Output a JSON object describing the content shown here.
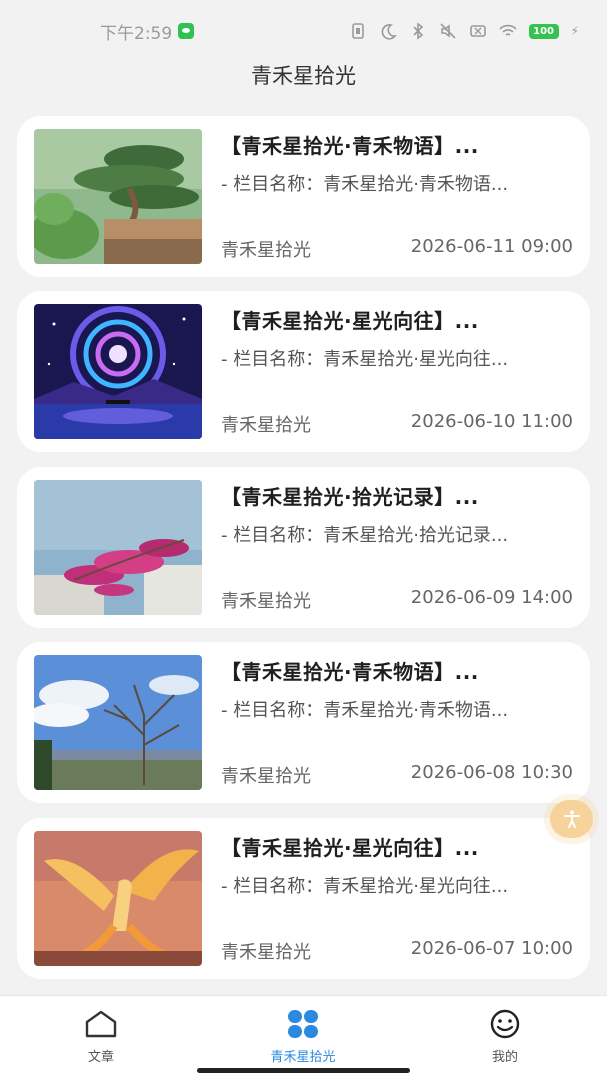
{
  "status_bar": {
    "time": "下午2:59",
    "battery": "100"
  },
  "header": {
    "title": "青禾星拾光"
  },
  "articles": [
    {
      "title": "【青禾星拾光·青禾物语】...",
      "desc": "- 栏目名称：青禾星拾光·青禾物语...",
      "author": "青禾星拾光",
      "date": "2026-06-11 09:00",
      "thumb": "bonsai-pine-image"
    },
    {
      "title": "【青禾星拾光·星光向往】...",
      "desc": "- 栏目名称：青禾星拾光·星光向往...",
      "author": "青禾星拾光",
      "date": "2026-06-10 11:00",
      "thumb": "galaxy-swirl-image"
    },
    {
      "title": "【青禾星拾光·拾光记录】...",
      "desc": "- 栏目名称：青禾星拾光·拾光记录...",
      "author": "青禾星拾光",
      "date": "2026-06-09 14:00",
      "thumb": "bougainvillea-sky-image"
    },
    {
      "title": "【青禾星拾光·青禾物语】...",
      "desc": "- 栏目名称：青禾星拾光·青禾物语...",
      "author": "青禾星拾光",
      "date": "2026-06-08 10:30",
      "thumb": "bare-tree-landscape-image"
    },
    {
      "title": "【青禾星拾光·星光向往】...",
      "desc": "- 栏目名称：青禾星拾光·星光向往...",
      "author": "青禾星拾光",
      "date": "2026-06-07 10:00",
      "thumb": "golden-phoenix-image"
    }
  ],
  "tabbar": {
    "tabs": [
      {
        "label": "文章",
        "icon": "home-icon"
      },
      {
        "label": "青禾星拾光",
        "icon": "four-petal-icon",
        "active": true
      },
      {
        "label": "我的",
        "icon": "smiley-icon"
      }
    ],
    "active_color": "#2a8ae0"
  },
  "floating_button": {
    "icon": "accessibility-icon",
    "color": "#f6d39a"
  }
}
